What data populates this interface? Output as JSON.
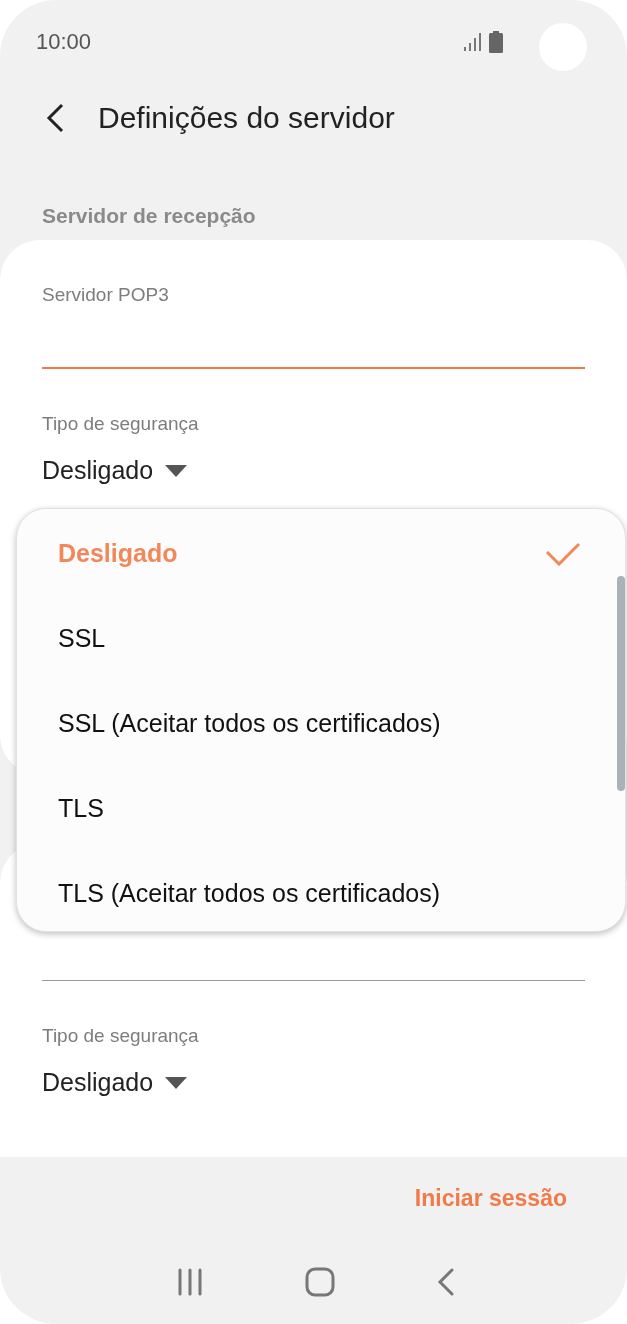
{
  "status_bar": {
    "time": "10:00"
  },
  "header": {
    "title": "Definições do servidor"
  },
  "section": {
    "title": "Servidor de recepção"
  },
  "incoming": {
    "server_field": {
      "label": "Servidor POP3",
      "focused": true
    },
    "security": {
      "label": "Tipo de segurança",
      "value": "Desligado"
    }
  },
  "outgoing": {
    "server_field": {
      "focused": false
    },
    "security": {
      "label": "Tipo de segurança",
      "value": "Desligado"
    }
  },
  "dropdown": {
    "options": [
      {
        "label": "Desligado",
        "selected": true
      },
      {
        "label": "SSL",
        "selected": false
      },
      {
        "label": "SSL (Aceitar todos os certificados)",
        "selected": false
      },
      {
        "label": "TLS",
        "selected": false
      },
      {
        "label": "TLS (Aceitar todos os certificados)",
        "selected": false
      }
    ]
  },
  "footer": {
    "button": "Iniciar sessão"
  }
}
